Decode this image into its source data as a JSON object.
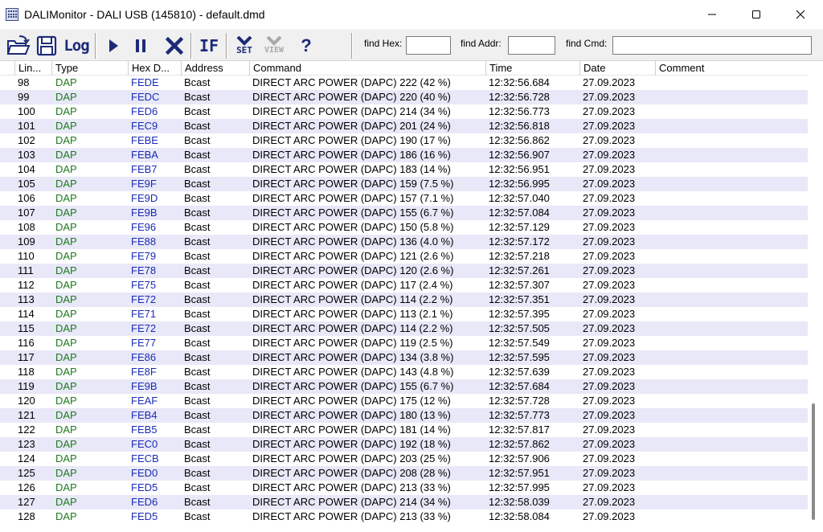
{
  "window": {
    "title": "DALIMonitor - DALI USB (145810) - default.dmd",
    "minimize_glyph": "—",
    "maximize_glyph": "☐",
    "close_glyph": "✕"
  },
  "toolbar": {
    "open_icon": "open-folder-icon",
    "save_icon": "floppy-disk-icon",
    "log_label": "Log",
    "play_icon": "play-icon",
    "pause_icon": "pause-icon",
    "stop_icon": "x-icon",
    "if_label": "IF",
    "set_label": "SET",
    "view_label": "VIEW",
    "help_label": "?",
    "find_hex_label": "find Hex:",
    "find_hex_value": "",
    "find_addr_label": "find Addr:",
    "find_addr_value": "",
    "find_cmd_label": "find Cmd:",
    "find_cmd_value": ""
  },
  "table": {
    "columns": [
      "Lin...",
      "Type",
      "Hex D...",
      "Address",
      "Command",
      "Time",
      "Date",
      "Comment"
    ],
    "rows": [
      {
        "line": "98",
        "type": "DAP",
        "hex": "FEDE",
        "address": "Bcast",
        "command": "DIRECT ARC POWER (DAPC) 222 (42 %)",
        "time": "12:32:56.684",
        "date": "27.09.2023",
        "comment": ""
      },
      {
        "line": "99",
        "type": "DAP",
        "hex": "FEDC",
        "address": "Bcast",
        "command": "DIRECT ARC POWER (DAPC) 220 (40 %)",
        "time": "12:32:56.728",
        "date": "27.09.2023",
        "comment": ""
      },
      {
        "line": "100",
        "type": "DAP",
        "hex": "FED6",
        "address": "Bcast",
        "command": "DIRECT ARC POWER (DAPC) 214 (34 %)",
        "time": "12:32:56.773",
        "date": "27.09.2023",
        "comment": ""
      },
      {
        "line": "101",
        "type": "DAP",
        "hex": "FEC9",
        "address": "Bcast",
        "command": "DIRECT ARC POWER (DAPC) 201 (24 %)",
        "time": "12:32:56.818",
        "date": "27.09.2023",
        "comment": ""
      },
      {
        "line": "102",
        "type": "DAP",
        "hex": "FEBE",
        "address": "Bcast",
        "command": "DIRECT ARC POWER (DAPC) 190 (17 %)",
        "time": "12:32:56.862",
        "date": "27.09.2023",
        "comment": ""
      },
      {
        "line": "103",
        "type": "DAP",
        "hex": "FEBA",
        "address": "Bcast",
        "command": "DIRECT ARC POWER (DAPC) 186 (16 %)",
        "time": "12:32:56.907",
        "date": "27.09.2023",
        "comment": ""
      },
      {
        "line": "104",
        "type": "DAP",
        "hex": "FEB7",
        "address": "Bcast",
        "command": "DIRECT ARC POWER (DAPC) 183 (14 %)",
        "time": "12:32:56.951",
        "date": "27.09.2023",
        "comment": ""
      },
      {
        "line": "105",
        "type": "DAP",
        "hex": "FE9F",
        "address": "Bcast",
        "command": "DIRECT ARC POWER (DAPC) 159 (7.5 %)",
        "time": "12:32:56.995",
        "date": "27.09.2023",
        "comment": ""
      },
      {
        "line": "106",
        "type": "DAP",
        "hex": "FE9D",
        "address": "Bcast",
        "command": "DIRECT ARC POWER (DAPC) 157 (7.1 %)",
        "time": "12:32:57.040",
        "date": "27.09.2023",
        "comment": ""
      },
      {
        "line": "107",
        "type": "DAP",
        "hex": "FE9B",
        "address": "Bcast",
        "command": "DIRECT ARC POWER (DAPC) 155 (6.7 %)",
        "time": "12:32:57.084",
        "date": "27.09.2023",
        "comment": ""
      },
      {
        "line": "108",
        "type": "DAP",
        "hex": "FE96",
        "address": "Bcast",
        "command": "DIRECT ARC POWER (DAPC) 150 (5.8 %)",
        "time": "12:32:57.129",
        "date": "27.09.2023",
        "comment": ""
      },
      {
        "line": "109",
        "type": "DAP",
        "hex": "FE88",
        "address": "Bcast",
        "command": "DIRECT ARC POWER (DAPC) 136 (4.0 %)",
        "time": "12:32:57.172",
        "date": "27.09.2023",
        "comment": ""
      },
      {
        "line": "110",
        "type": "DAP",
        "hex": "FE79",
        "address": "Bcast",
        "command": "DIRECT ARC POWER (DAPC) 121 (2.6 %)",
        "time": "12:32:57.218",
        "date": "27.09.2023",
        "comment": ""
      },
      {
        "line": "111",
        "type": "DAP",
        "hex": "FE78",
        "address": "Bcast",
        "command": "DIRECT ARC POWER (DAPC) 120 (2.6 %)",
        "time": "12:32:57.261",
        "date": "27.09.2023",
        "comment": ""
      },
      {
        "line": "112",
        "type": "DAP",
        "hex": "FE75",
        "address": "Bcast",
        "command": "DIRECT ARC POWER (DAPC) 117 (2.4 %)",
        "time": "12:32:57.307",
        "date": "27.09.2023",
        "comment": ""
      },
      {
        "line": "113",
        "type": "DAP",
        "hex": "FE72",
        "address": "Bcast",
        "command": "DIRECT ARC POWER (DAPC) 114 (2.2 %)",
        "time": "12:32:57.351",
        "date": "27.09.2023",
        "comment": ""
      },
      {
        "line": "114",
        "type": "DAP",
        "hex": "FE71",
        "address": "Bcast",
        "command": "DIRECT ARC POWER (DAPC) 113 (2.1 %)",
        "time": "12:32:57.395",
        "date": "27.09.2023",
        "comment": ""
      },
      {
        "line": "115",
        "type": "DAP",
        "hex": "FE72",
        "address": "Bcast",
        "command": "DIRECT ARC POWER (DAPC) 114 (2.2 %)",
        "time": "12:32:57.505",
        "date": "27.09.2023",
        "comment": ""
      },
      {
        "line": "116",
        "type": "DAP",
        "hex": "FE77",
        "address": "Bcast",
        "command": "DIRECT ARC POWER (DAPC) 119 (2.5 %)",
        "time": "12:32:57.549",
        "date": "27.09.2023",
        "comment": ""
      },
      {
        "line": "117",
        "type": "DAP",
        "hex": "FE86",
        "address": "Bcast",
        "command": "DIRECT ARC POWER (DAPC) 134 (3.8 %)",
        "time": "12:32:57.595",
        "date": "27.09.2023",
        "comment": ""
      },
      {
        "line": "118",
        "type": "DAP",
        "hex": "FE8F",
        "address": "Bcast",
        "command": "DIRECT ARC POWER (DAPC) 143 (4.8 %)",
        "time": "12:32:57.639",
        "date": "27.09.2023",
        "comment": ""
      },
      {
        "line": "119",
        "type": "DAP",
        "hex": "FE9B",
        "address": "Bcast",
        "command": "DIRECT ARC POWER (DAPC) 155 (6.7 %)",
        "time": "12:32:57.684",
        "date": "27.09.2023",
        "comment": ""
      },
      {
        "line": "120",
        "type": "DAP",
        "hex": "FEAF",
        "address": "Bcast",
        "command": "DIRECT ARC POWER (DAPC) 175 (12 %)",
        "time": "12:32:57.728",
        "date": "27.09.2023",
        "comment": ""
      },
      {
        "line": "121",
        "type": "DAP",
        "hex": "FEB4",
        "address": "Bcast",
        "command": "DIRECT ARC POWER (DAPC) 180 (13 %)",
        "time": "12:32:57.773",
        "date": "27.09.2023",
        "comment": ""
      },
      {
        "line": "122",
        "type": "DAP",
        "hex": "FEB5",
        "address": "Bcast",
        "command": "DIRECT ARC POWER (DAPC) 181 (14 %)",
        "time": "12:32:57.817",
        "date": "27.09.2023",
        "comment": ""
      },
      {
        "line": "123",
        "type": "DAP",
        "hex": "FEC0",
        "address": "Bcast",
        "command": "DIRECT ARC POWER (DAPC) 192 (18 %)",
        "time": "12:32:57.862",
        "date": "27.09.2023",
        "comment": ""
      },
      {
        "line": "124",
        "type": "DAP",
        "hex": "FECB",
        "address": "Bcast",
        "command": "DIRECT ARC POWER (DAPC) 203 (25 %)",
        "time": "12:32:57.906",
        "date": "27.09.2023",
        "comment": ""
      },
      {
        "line": "125",
        "type": "DAP",
        "hex": "FED0",
        "address": "Bcast",
        "command": "DIRECT ARC POWER (DAPC) 208 (28 %)",
        "time": "12:32:57.951",
        "date": "27.09.2023",
        "comment": ""
      },
      {
        "line": "126",
        "type": "DAP",
        "hex": "FED5",
        "address": "Bcast",
        "command": "DIRECT ARC POWER (DAPC) 213 (33 %)",
        "time": "12:32:57.995",
        "date": "27.09.2023",
        "comment": ""
      },
      {
        "line": "127",
        "type": "DAP",
        "hex": "FED6",
        "address": "Bcast",
        "command": "DIRECT ARC POWER (DAPC) 214 (34 %)",
        "time": "12:32:58.039",
        "date": "27.09.2023",
        "comment": ""
      },
      {
        "line": "128",
        "type": "DAP",
        "hex": "FED5",
        "address": "Bcast",
        "command": "DIRECT ARC POWER (DAPC) 213 (33 %)",
        "time": "12:32:58.084",
        "date": "27.09.2023",
        "comment": ""
      }
    ]
  },
  "colors": {
    "type_text": "#1e7a1e",
    "hex_text": "#1a2bb4",
    "alt_row": "#e8e8f8",
    "toolbar_icon": "#1c2a78"
  }
}
